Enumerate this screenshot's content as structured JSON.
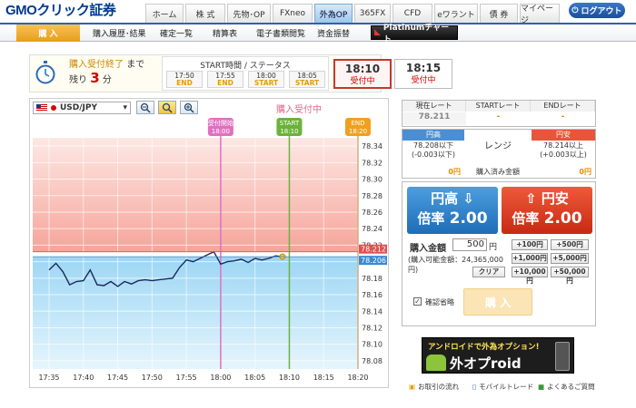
{
  "brand": {
    "logo": "GMOクリック証券"
  },
  "global_nav": [
    {
      "label": "ホーム"
    },
    {
      "label": "株 式"
    },
    {
      "label": "先物･OP"
    },
    {
      "label": "FXneo"
    },
    {
      "label": "外為OP",
      "active": true
    },
    {
      "label": "365FX"
    },
    {
      "label": "CFD"
    },
    {
      "label": "eワラント"
    },
    {
      "label": "債 券"
    },
    {
      "label": "マイページ"
    }
  ],
  "logout_label": "ログアウト",
  "sub_nav": [
    {
      "label": "購 入"
    },
    {
      "label": "購入履歴･結果"
    },
    {
      "label": "確定一覧"
    },
    {
      "label": "精算表"
    },
    {
      "label": "電子書類閲覧"
    },
    {
      "label": "資金振替"
    }
  ],
  "platinum_label": "Platinumチャート",
  "status": {
    "end_label": "購入受付終了",
    "made": "まで",
    "remain": "残り",
    "minutes": "3",
    "unit": "分",
    "header": "START時間 / ステータス",
    "slots": [
      {
        "time": "17:50",
        "status": "END"
      },
      {
        "time": "17:55",
        "status": "END"
      },
      {
        "time": "18:00",
        "status": "START"
      },
      {
        "time": "18:05",
        "status": "START"
      }
    ],
    "big_slots": [
      {
        "time": "18:10",
        "status": "受付中"
      },
      {
        "time": "18:15",
        "status": "受付中"
      }
    ]
  },
  "chart_toolbar": {
    "pair": "USD/JPY",
    "status_text": "購入受付中"
  },
  "chart_data": {
    "type": "line",
    "x_labels": [
      "17:35",
      "17:40",
      "17:45",
      "17:50",
      "17:55",
      "18:00",
      "18:05",
      "18:10",
      "18:15",
      "18:20"
    ],
    "y_ticks": [
      "78.34",
      "78.32",
      "78.30",
      "78.28",
      "78.26",
      "78.24",
      "78.22",
      "78.20",
      "78.18",
      "78.16",
      "78.14",
      "78.12",
      "78.10",
      "78.08"
    ],
    "ylim": [
      78.07,
      78.35
    ],
    "upper_threshold": 78.212,
    "upper_label": "78.212",
    "current": 78.206,
    "current_label": "78.206",
    "markers": [
      {
        "label": "受付開始",
        "time": "18:00",
        "color": "#e070c0"
      },
      {
        "label": "START",
        "time": "18:10",
        "color": "#6ab33a"
      },
      {
        "label": "END",
        "time": "18:20",
        "color": "#f0a020"
      }
    ],
    "series": [
      {
        "x_minutes": [
          0,
          1,
          2,
          3,
          4,
          5,
          6,
          7,
          8,
          9,
          10,
          11,
          12,
          13,
          14,
          15,
          16,
          17,
          18,
          19,
          20,
          21,
          22,
          23,
          24,
          25,
          26,
          27,
          28,
          29,
          30,
          31,
          32,
          33,
          34
        ],
        "values": [
          78.19,
          78.198,
          78.188,
          78.172,
          78.176,
          78.177,
          78.19,
          78.172,
          78.171,
          78.176,
          78.17,
          78.176,
          78.173,
          78.177,
          78.178,
          78.177,
          78.178,
          78.179,
          78.18,
          78.193,
          78.202,
          78.2,
          78.204,
          78.208,
          78.212,
          78.197,
          78.2,
          78.201,
          78.203,
          78.199,
          78.204,
          78.202,
          78.204,
          78.207,
          78.206
        ]
      }
    ]
  },
  "rates": {
    "headers": [
      "現在レート",
      "STARTレート",
      "ENDレート"
    ],
    "values": [
      "78.211",
      "-",
      "-"
    ]
  },
  "range": {
    "high_label": "円高",
    "high_text": "78.208以下",
    "high_sub": "(-0.003以下)",
    "high_amount": "0円",
    "range_label": "レンジ",
    "low_label": "円安",
    "low_text": "78.214以上",
    "low_sub": "(+0.003以上)",
    "low_amount": "0円",
    "purchased_label": "購入済み金額"
  },
  "order": {
    "up_label": "円高 ⇩",
    "up_mult_label": "倍率",
    "up_mult": "2.00",
    "down_label": "⇧ 円安",
    "down_mult_label": "倍率",
    "down_mult": "2.00",
    "amount_label": "購入金額",
    "amount_value": "500",
    "amount_unit": "円",
    "available": "(購入可能金額：24,365,000円)",
    "amount_buttons": [
      "+100円",
      "+500円",
      "+1,000円",
      "+5,000円",
      "クリア",
      "+10,000円",
      "+50,000円"
    ],
    "confirm_label": "確認省略",
    "buy_label": "購 入"
  },
  "banner": {
    "line1": "アンドロイドで外為オプション!",
    "line2": "外オプroid"
  },
  "footer": [
    {
      "label": "お取引の流れ"
    },
    {
      "label": "モバイルトレード"
    },
    {
      "label": "よくあるご質問"
    }
  ]
}
